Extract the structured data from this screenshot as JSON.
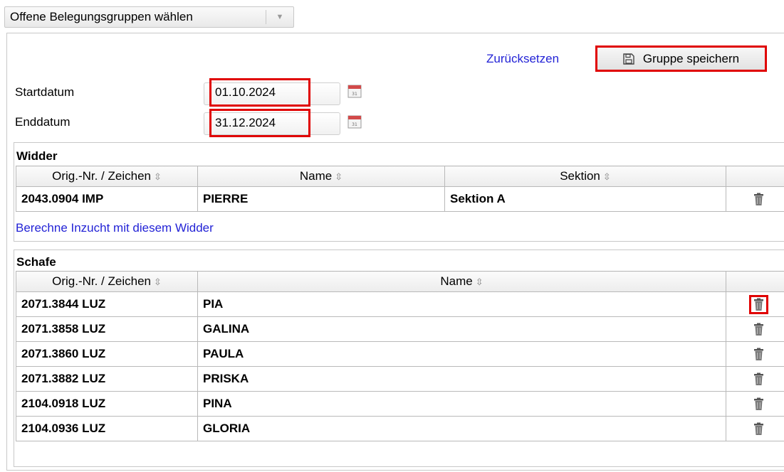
{
  "group_selector": {
    "label": "Offene Belegungsgruppen wählen"
  },
  "toolbar": {
    "reset_label": "Zurücksetzen",
    "save_label": "Gruppe speichern"
  },
  "dates": {
    "start_label": "Startdatum",
    "start_value": "01.10.2024",
    "end_label": "Enddatum",
    "end_value": "31.12.2024"
  },
  "rams": {
    "title": "Widder",
    "columns": [
      "Orig.-Nr. / Zeichen",
      "Name",
      "Sektion"
    ],
    "rows": [
      {
        "nr": "2043.0904 IMP",
        "name": "PIERRE",
        "section": "Sektion A"
      }
    ],
    "inbreeding_link": "Berechne Inzucht mit diesem Widder"
  },
  "sheep": {
    "title": "Schafe",
    "columns": [
      "Orig.-Nr. / Zeichen",
      "Name"
    ],
    "rows": [
      {
        "nr": "2071.3844 LUZ",
        "name": "PIA"
      },
      {
        "nr": "2071.3858 LUZ",
        "name": "GALINA"
      },
      {
        "nr": "2071.3860 LUZ",
        "name": "PAULA"
      },
      {
        "nr": "2071.3882 LUZ",
        "name": "PRISKA"
      },
      {
        "nr": "2104.0918 LUZ",
        "name": "PINA"
      },
      {
        "nr": "2104.0936 LUZ",
        "name": "GLORIA"
      }
    ]
  },
  "icons": {
    "sort": "sort-arrows-icon",
    "delete": "trash-icon",
    "calendar": "calendar-icon",
    "save": "floppy-disk-icon"
  },
  "colors": {
    "highlight": "#e00000",
    "link": "#2323d6"
  }
}
